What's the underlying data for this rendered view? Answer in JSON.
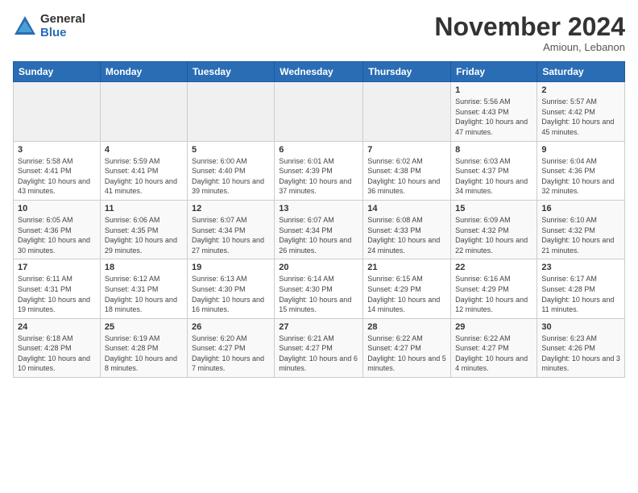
{
  "header": {
    "logo_general": "General",
    "logo_blue": "Blue",
    "month_title": "November 2024",
    "location": "Amioun, Lebanon"
  },
  "weekdays": [
    "Sunday",
    "Monday",
    "Tuesday",
    "Wednesday",
    "Thursday",
    "Friday",
    "Saturday"
  ],
  "weeks": [
    [
      {
        "day": "",
        "info": ""
      },
      {
        "day": "",
        "info": ""
      },
      {
        "day": "",
        "info": ""
      },
      {
        "day": "",
        "info": ""
      },
      {
        "day": "",
        "info": ""
      },
      {
        "day": "1",
        "info": "Sunrise: 5:56 AM\nSunset: 4:43 PM\nDaylight: 10 hours\nand 47 minutes."
      },
      {
        "day": "2",
        "info": "Sunrise: 5:57 AM\nSunset: 4:42 PM\nDaylight: 10 hours\nand 45 minutes."
      }
    ],
    [
      {
        "day": "3",
        "info": "Sunrise: 5:58 AM\nSunset: 4:41 PM\nDaylight: 10 hours\nand 43 minutes."
      },
      {
        "day": "4",
        "info": "Sunrise: 5:59 AM\nSunset: 4:41 PM\nDaylight: 10 hours\nand 41 minutes."
      },
      {
        "day": "5",
        "info": "Sunrise: 6:00 AM\nSunset: 4:40 PM\nDaylight: 10 hours\nand 39 minutes."
      },
      {
        "day": "6",
        "info": "Sunrise: 6:01 AM\nSunset: 4:39 PM\nDaylight: 10 hours\nand 37 minutes."
      },
      {
        "day": "7",
        "info": "Sunrise: 6:02 AM\nSunset: 4:38 PM\nDaylight: 10 hours\nand 36 minutes."
      },
      {
        "day": "8",
        "info": "Sunrise: 6:03 AM\nSunset: 4:37 PM\nDaylight: 10 hours\nand 34 minutes."
      },
      {
        "day": "9",
        "info": "Sunrise: 6:04 AM\nSunset: 4:36 PM\nDaylight: 10 hours\nand 32 minutes."
      }
    ],
    [
      {
        "day": "10",
        "info": "Sunrise: 6:05 AM\nSunset: 4:36 PM\nDaylight: 10 hours\nand 30 minutes."
      },
      {
        "day": "11",
        "info": "Sunrise: 6:06 AM\nSunset: 4:35 PM\nDaylight: 10 hours\nand 29 minutes."
      },
      {
        "day": "12",
        "info": "Sunrise: 6:07 AM\nSunset: 4:34 PM\nDaylight: 10 hours\nand 27 minutes."
      },
      {
        "day": "13",
        "info": "Sunrise: 6:07 AM\nSunset: 4:34 PM\nDaylight: 10 hours\nand 26 minutes."
      },
      {
        "day": "14",
        "info": "Sunrise: 6:08 AM\nSunset: 4:33 PM\nDaylight: 10 hours\nand 24 minutes."
      },
      {
        "day": "15",
        "info": "Sunrise: 6:09 AM\nSunset: 4:32 PM\nDaylight: 10 hours\nand 22 minutes."
      },
      {
        "day": "16",
        "info": "Sunrise: 6:10 AM\nSunset: 4:32 PM\nDaylight: 10 hours\nand 21 minutes."
      }
    ],
    [
      {
        "day": "17",
        "info": "Sunrise: 6:11 AM\nSunset: 4:31 PM\nDaylight: 10 hours\nand 19 minutes."
      },
      {
        "day": "18",
        "info": "Sunrise: 6:12 AM\nSunset: 4:31 PM\nDaylight: 10 hours\nand 18 minutes."
      },
      {
        "day": "19",
        "info": "Sunrise: 6:13 AM\nSunset: 4:30 PM\nDaylight: 10 hours\nand 16 minutes."
      },
      {
        "day": "20",
        "info": "Sunrise: 6:14 AM\nSunset: 4:30 PM\nDaylight: 10 hours\nand 15 minutes."
      },
      {
        "day": "21",
        "info": "Sunrise: 6:15 AM\nSunset: 4:29 PM\nDaylight: 10 hours\nand 14 minutes."
      },
      {
        "day": "22",
        "info": "Sunrise: 6:16 AM\nSunset: 4:29 PM\nDaylight: 10 hours\nand 12 minutes."
      },
      {
        "day": "23",
        "info": "Sunrise: 6:17 AM\nSunset: 4:28 PM\nDaylight: 10 hours\nand 11 minutes."
      }
    ],
    [
      {
        "day": "24",
        "info": "Sunrise: 6:18 AM\nSunset: 4:28 PM\nDaylight: 10 hours\nand 10 minutes."
      },
      {
        "day": "25",
        "info": "Sunrise: 6:19 AM\nSunset: 4:28 PM\nDaylight: 10 hours\nand 8 minutes."
      },
      {
        "day": "26",
        "info": "Sunrise: 6:20 AM\nSunset: 4:27 PM\nDaylight: 10 hours\nand 7 minutes."
      },
      {
        "day": "27",
        "info": "Sunrise: 6:21 AM\nSunset: 4:27 PM\nDaylight: 10 hours\nand 6 minutes."
      },
      {
        "day": "28",
        "info": "Sunrise: 6:22 AM\nSunset: 4:27 PM\nDaylight: 10 hours\nand 5 minutes."
      },
      {
        "day": "29",
        "info": "Sunrise: 6:22 AM\nSunset: 4:27 PM\nDaylight: 10 hours\nand 4 minutes."
      },
      {
        "day": "30",
        "info": "Sunrise: 6:23 AM\nSunset: 4:26 PM\nDaylight: 10 hours\nand 3 minutes."
      }
    ]
  ]
}
